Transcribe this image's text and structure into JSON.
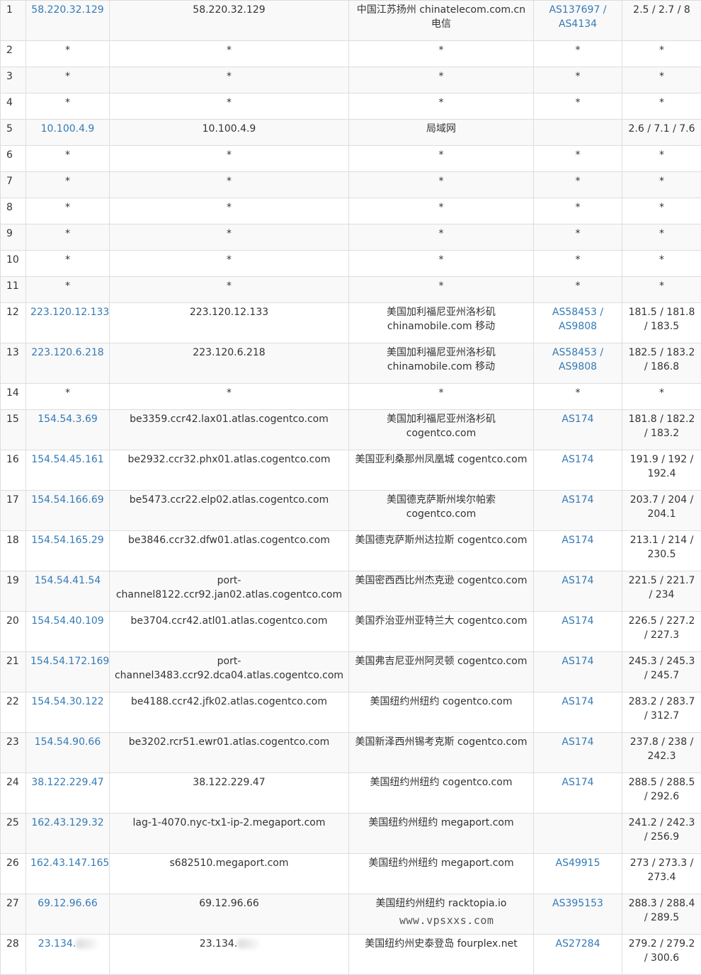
{
  "watermark": "www.vpsxxs.com",
  "rows": [
    {
      "hop": "1",
      "ip": "58.220.32.129",
      "host": "58.220.32.129",
      "loc": "中国江苏扬州 chinatelecom.com.cn 电信",
      "asn": "AS137697 / AS4134",
      "rtt": "2.5 / 2.7 / 8"
    },
    {
      "hop": "2",
      "ip": "*",
      "host": "*",
      "loc": "*",
      "asn": "*",
      "rtt": "*"
    },
    {
      "hop": "3",
      "ip": "*",
      "host": "*",
      "loc": "*",
      "asn": "*",
      "rtt": "*"
    },
    {
      "hop": "4",
      "ip": "*",
      "host": "*",
      "loc": "*",
      "asn": "*",
      "rtt": "*"
    },
    {
      "hop": "5",
      "ip": "10.100.4.9",
      "host": "10.100.4.9",
      "loc": "局域网",
      "asn": "",
      "rtt": "2.6 / 7.1 / 7.6"
    },
    {
      "hop": "6",
      "ip": "*",
      "host": "*",
      "loc": "*",
      "asn": "*",
      "rtt": "*"
    },
    {
      "hop": "7",
      "ip": "*",
      "host": "*",
      "loc": "*",
      "asn": "*",
      "rtt": "*"
    },
    {
      "hop": "8",
      "ip": "*",
      "host": "*",
      "loc": "*",
      "asn": "*",
      "rtt": "*"
    },
    {
      "hop": "9",
      "ip": "*",
      "host": "*",
      "loc": "*",
      "asn": "*",
      "rtt": "*"
    },
    {
      "hop": "10",
      "ip": "*",
      "host": "*",
      "loc": "*",
      "asn": "*",
      "rtt": "*"
    },
    {
      "hop": "11",
      "ip": "*",
      "host": "*",
      "loc": "*",
      "asn": "*",
      "rtt": "*"
    },
    {
      "hop": "12",
      "ip": "223.120.12.133",
      "host": "223.120.12.133",
      "loc": "美国加利福尼亚州洛杉矶 chinamobile.com 移动",
      "asn": "AS58453 / AS9808",
      "rtt": "181.5 / 181.8 / 183.5"
    },
    {
      "hop": "13",
      "ip": "223.120.6.218",
      "host": "223.120.6.218",
      "loc": "美国加利福尼亚州洛杉矶 chinamobile.com 移动",
      "asn": "AS58453 / AS9808",
      "rtt": "182.5 / 183.2 / 186.8"
    },
    {
      "hop": "14",
      "ip": "*",
      "host": "*",
      "loc": "*",
      "asn": "*",
      "rtt": "*"
    },
    {
      "hop": "15",
      "ip": "154.54.3.69",
      "host": "be3359.ccr42.lax01.atlas.cogentco.com",
      "loc": "美国加利福尼亚州洛杉矶 cogentco.com",
      "asn": "AS174",
      "rtt": "181.8 / 182.2 / 183.2"
    },
    {
      "hop": "16",
      "ip": "154.54.45.161",
      "host": "be2932.ccr32.phx01.atlas.cogentco.com",
      "loc": "美国亚利桑那州凤凰城 cogentco.com",
      "asn": "AS174",
      "rtt": "191.9 / 192 / 192.4"
    },
    {
      "hop": "17",
      "ip": "154.54.166.69",
      "host": "be5473.ccr22.elp02.atlas.cogentco.com",
      "loc": "美国德克萨斯州埃尔帕索 cogentco.com",
      "asn": "AS174",
      "rtt": "203.7 / 204 / 204.1"
    },
    {
      "hop": "18",
      "ip": "154.54.165.29",
      "host": "be3846.ccr32.dfw01.atlas.cogentco.com",
      "loc": "美国德克萨斯州达拉斯 cogentco.com",
      "asn": "AS174",
      "rtt": "213.1 / 214 / 230.5"
    },
    {
      "hop": "19",
      "ip": "154.54.41.54",
      "host": "port-channel8122.ccr92.jan02.atlas.cogentco.com",
      "loc": "美国密西西比州杰克逊 cogentco.com",
      "asn": "AS174",
      "rtt": "221.5 / 221.7 / 234"
    },
    {
      "hop": "20",
      "ip": "154.54.40.109",
      "host": "be3704.ccr42.atl01.atlas.cogentco.com",
      "loc": "美国乔治亚州亚特兰大 cogentco.com",
      "asn": "AS174",
      "rtt": "226.5 / 227.2 / 227.3"
    },
    {
      "hop": "21",
      "ip": "154.54.172.169",
      "host": "port-channel3483.ccr92.dca04.atlas.cogentco.com",
      "loc": "美国弗吉尼亚州阿灵顿 cogentco.com",
      "asn": "AS174",
      "rtt": "245.3 / 245.3 / 245.7"
    },
    {
      "hop": "22",
      "ip": "154.54.30.122",
      "host": "be4188.ccr42.jfk02.atlas.cogentco.com",
      "loc": "美国纽约州纽约 cogentco.com",
      "asn": "AS174",
      "rtt": "283.2 / 283.7 / 312.7"
    },
    {
      "hop": "23",
      "ip": "154.54.90.66",
      "host": "be3202.rcr51.ewr01.atlas.cogentco.com",
      "loc": "美国新泽西州锡考克斯 cogentco.com",
      "asn": "AS174",
      "rtt": "237.8 / 238 / 242.3"
    },
    {
      "hop": "24",
      "ip": "38.122.229.47",
      "host": "38.122.229.47",
      "loc": "美国纽约州纽约 cogentco.com",
      "asn": "AS174",
      "rtt": "288.5 / 288.5 / 292.6"
    },
    {
      "hop": "25",
      "ip": "162.43.129.32",
      "host": "lag-1-4070.nyc-tx1-ip-2.megaport.com",
      "loc": "美国纽约州纽约 megaport.com",
      "asn": "",
      "rtt": "241.2 / 242.3 / 256.9"
    },
    {
      "hop": "26",
      "ip": "162.43.147.165",
      "host": "s682510.megaport.com",
      "loc": "美国纽约州纽约 megaport.com",
      "asn": "AS49915",
      "rtt": "273 / 273.3 / 273.4"
    },
    {
      "hop": "27",
      "ip": "69.12.96.66",
      "host": "69.12.96.66",
      "loc": "美国纽约州纽约 racktopia.io",
      "asn": "AS395153",
      "rtt": "288.3 / 288.4 / 289.5"
    },
    {
      "hop": "28",
      "ip": "23.134.",
      "host": "23.134.",
      "loc": "美国纽约州史泰登岛 fourplex.net",
      "asn": "AS27284",
      "rtt": "279.2 / 279.2 / 300.6"
    }
  ]
}
